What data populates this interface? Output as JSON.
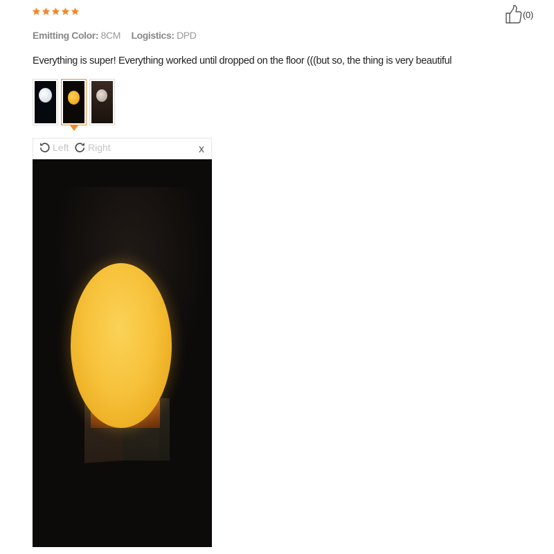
{
  "rating": {
    "stars": 5,
    "max_stars": 5,
    "star_color": "#f28a2b"
  },
  "helpful": {
    "icon": "thumbs-up-icon",
    "count_label": "(0)"
  },
  "meta": {
    "color_label": "Emitting Color:",
    "color_value": "8CM",
    "logistics_label": "Logistics:",
    "logistics_value": "DPD"
  },
  "review_text": "Everything is super! Everything worked until dropped on the floor (((but so, the thing is very beautiful",
  "thumbnails": [
    {
      "name": "white-moon-lamp-photo",
      "active": false
    },
    {
      "name": "yellow-moon-lamp-photo",
      "active": true
    },
    {
      "name": "moon-lamp-box-photo",
      "active": false
    }
  ],
  "viewer": {
    "rotate_left_label": "Left",
    "rotate_right_label": "Right",
    "close_label": "x",
    "accent_color": "#f28a2b"
  }
}
